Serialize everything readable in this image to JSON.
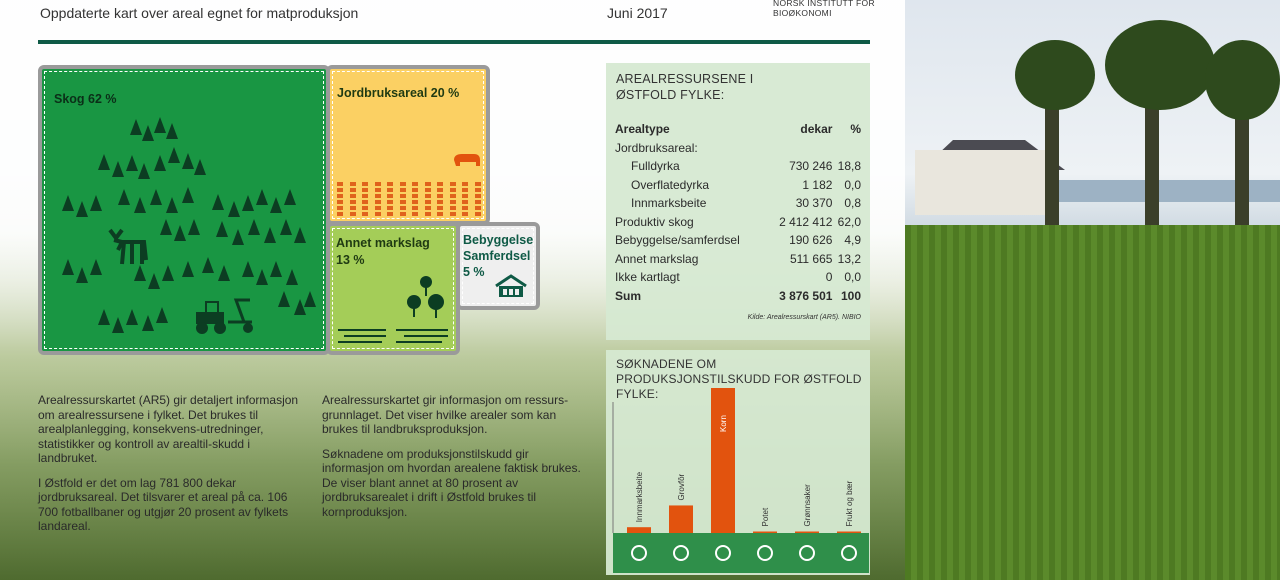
{
  "header": {
    "title": "Oppdaterte kart over areal egnet for matproduksjon",
    "date": "Juni 2017",
    "logo_line1": "NORSK INSTITUTT FOR",
    "logo_line2": "BIOØKONOMI"
  },
  "landuse": {
    "skog": "Skog 62 %",
    "jordbruk": "Jordbruksareal 20 %",
    "annet_1": "Annet markslag",
    "annet_2": "13 %",
    "bebyg_1": "Bebyggelse",
    "bebyg_2": "Samferdsel",
    "bebyg_3": "5 %",
    "colors": {
      "skog": "#199643",
      "jordbruk": "#fbd063",
      "annet": "#a4cd58",
      "bebyg": "#efefef"
    }
  },
  "text": {
    "col1_p1": "Arealressurskartet (AR5) gir detaljert informasjon om arealressursene i fylket. Det brukes til arealplanlegging, konsekvens-utredninger, statistikker og kontroll av arealtil-skudd i landbruket.",
    "col1_p2": "I Østfold er det om lag 781 800 dekar jordbruksareal. Det tilsvarer et areal på ca. 106 700 fotballbaner og utgjør 20 prosent av fylkets landareal.",
    "col2_p1": "Arealressurskartet gir informasjon om ressurs-grunnlaget. Det viser hvilke arealer som kan brukes til landbruksproduksjon.",
    "col2_p2": "Søknadene om produksjonstilskudd gir informasjon om hvordan arealene faktisk brukes. De viser blant annet at 80 prosent av jordbruksarealet i drift i Østfold brukes til kornproduksjon."
  },
  "table": {
    "title_1": "AREALRESSURSENE I",
    "title_2": "ØSTFOLD FYLKE:",
    "headers": [
      "Arealtype",
      "dekar",
      "%"
    ],
    "rows": [
      [
        "Jordbruksareal:",
        "",
        ""
      ],
      [
        "Fulldyrka",
        "730 246",
        "18,8"
      ],
      [
        "Overflatedyrka",
        "1 182",
        "0,0"
      ],
      [
        "Innmarksbeite",
        "30 370",
        "0,8"
      ],
      [
        "Produktiv skog",
        "2 412 412",
        "62,0"
      ],
      [
        "Bebyggelse/samferdsel",
        "190 626",
        "4,9"
      ],
      [
        "Annet markslag",
        "511 665",
        "13,2"
      ],
      [
        "Ikke kartlagt",
        "0",
        "0,0"
      ],
      [
        "Sum",
        "3 876 501",
        "100"
      ]
    ],
    "source": "Kilde: Arealressurskart (AR5). NIBIO"
  },
  "chart_data": {
    "type": "bar",
    "title": "SØKNADENE OM PRODUKSJONSTILSKUDD FOR ØSTFOLD FYLKE:",
    "categories": [
      "Innmarksbeite",
      "Grovfôr",
      "Korn",
      "Potet",
      "Grønnsaker",
      "Frukt og bær"
    ],
    "values": [
      4,
      19,
      100,
      1,
      1,
      0
    ],
    "ylim": [
      0,
      100
    ],
    "color": "#e2530e",
    "icons": [
      "cow-icon",
      "grass-bale-icon",
      "grain-icon",
      "potato-icon",
      "vegetable-icon",
      "fruit-icon"
    ]
  }
}
